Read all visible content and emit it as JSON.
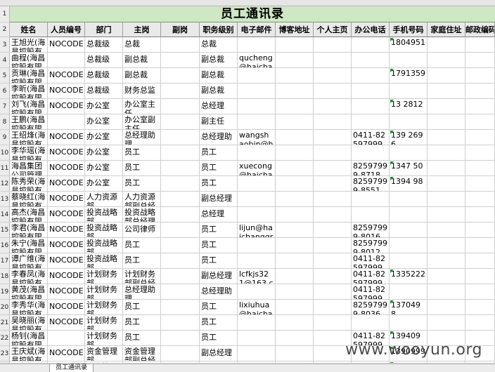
{
  "app": {
    "sheet_tab": "员工通讯录"
  },
  "title": "员工通讯录",
  "columns": [
    "姓名",
    "人员编号",
    "部门",
    "主岗",
    "副岗",
    "职务级别",
    "电子邮件",
    "博客地址",
    "个人主页",
    "办公电话",
    "手机号码",
    "家庭住址",
    "邮政编码"
  ],
  "row_numbers": [
    "1",
    "2",
    "3",
    "4",
    "5",
    "6",
    "7",
    "8",
    "9",
    "10",
    "11",
    "12",
    "13",
    "14",
    "15",
    "16",
    "17",
    "18",
    "19",
    "20",
    "21",
    "22",
    "23",
    "24"
  ],
  "rows": [
    {
      "name": "王旭光(海昌控股有",
      "code": "NOCODE",
      "dept": "总裁级",
      "main": "总裁",
      "sub": "",
      "level": "总裁",
      "email": "",
      "blog": "",
      "home": "",
      "phone": "",
      "mobile": "1804951"
    },
    {
      "name": "曲程(海昌控股有限",
      "code": "",
      "dept": "总裁级",
      "main": "副总裁",
      "sub": "",
      "level": "副总裁",
      "email": "qucheng@haichan",
      "blog": "",
      "home": "",
      "phone": "",
      "mobile": ""
    },
    {
      "name": "贡琳(海昌控股有限",
      "code": "NOCODE",
      "dept": "总裁级",
      "main": "副总裁",
      "sub": "",
      "level": "副总裁",
      "email": "",
      "blog": "",
      "home": "",
      "phone": "",
      "mobile": "1791359"
    },
    {
      "name": "李昕(海昌控股有限",
      "code": "NOCODE",
      "dept": "总裁级",
      "main": "财务总监",
      "sub": "",
      "level": "副总裁",
      "email": "",
      "blog": "",
      "home": "",
      "phone": "",
      "mobile": ""
    },
    {
      "name": "刘飞(海昌控股有限",
      "code": "NOCODE",
      "dept": "办公室",
      "main": "办公室主任",
      "sub": "",
      "level": "总经理",
      "email": "",
      "blog": "",
      "home": "",
      "phone": "",
      "mobile": "13 2812"
    },
    {
      "name": "王鹏(海昌控股有限",
      "code": "",
      "dept": "办公室",
      "main": "办公室副主任",
      "sub": "",
      "level": "副主任",
      "email": "",
      "blog": "",
      "home": "",
      "phone": "",
      "mobile": ""
    },
    {
      "name": "王绍烽(海昌控股有",
      "code": "NOCODE",
      "dept": "办公室",
      "main": "总经理助理",
      "sub": "",
      "level": "总经理助",
      "email": "wangshaobin@hai",
      "blog": "",
      "home": "",
      "phone": "0411-82597999",
      "mobile": "139 2696"
    },
    {
      "name": "李华瑶(海昌控股有",
      "code": "NOCODE",
      "dept": "办公室",
      "main": "员工",
      "sub": "",
      "level": "员工",
      "email": "",
      "blog": "",
      "home": "",
      "phone": "",
      "mobile": ""
    },
    {
      "name": "海昌集团公司管理",
      "code": "NOCODE",
      "dept": "办公室",
      "main": "员工",
      "sub": "",
      "level": "员工",
      "email": "xuecong@haichan",
      "blog": "",
      "home": "",
      "phone": "82597999-8718",
      "mobile": "1347 50"
    },
    {
      "name": "陈秀荣(海昌控股有",
      "code": "NOCODE",
      "dept": "办公室",
      "main": "员工",
      "sub": "",
      "level": "员工",
      "email": "",
      "blog": "",
      "home": "",
      "phone": "82597999-8551",
      "mobile": "1394 98"
    },
    {
      "name": "蔡晓红(海昌控股有",
      "code": "NOCODE",
      "dept": "人力资源部",
      "main": "人力资源部副总经",
      "sub": "",
      "level": "副总经理",
      "email": "",
      "blog": "",
      "home": "",
      "phone": "",
      "mobile": ""
    },
    {
      "name": "高杰(海昌控股有限",
      "code": "NOCODE",
      "dept": "投资战略部",
      "main": "投资战略部总经理",
      "sub": "",
      "level": "总经理",
      "email": "",
      "blog": "",
      "home": "",
      "phone": "",
      "mobile": ""
    },
    {
      "name": "李君(海昌控股有限",
      "code": "NOCODE",
      "dept": "投资战略部",
      "main": "公司律师",
      "sub": "",
      "level": "员工",
      "email": "lijun@haichanggrou",
      "blog": "",
      "home": "",
      "phone": "82597999-8016",
      "mobile": ""
    },
    {
      "name": "朱宁(海昌控股有限",
      "code": "NOCODE",
      "dept": "投资战略部",
      "main": "员工",
      "sub": "",
      "level": "员工",
      "email": "",
      "blog": "",
      "home": "",
      "phone": "82597999-8012",
      "mobile": ""
    },
    {
      "name": "谭广维(海昌控股有",
      "code": "NOCODE",
      "dept": "投资战略部",
      "main": "员工",
      "sub": "",
      "level": "员工",
      "email": "",
      "blog": "",
      "home": "",
      "phone": "0411-82597999",
      "mobile": ""
    },
    {
      "name": "李春凤(海昌控股有",
      "code": "NOCODE",
      "dept": "计划财务部",
      "main": "计划财务部副总经",
      "sub": "",
      "level": "副总经理",
      "email": "lcfkjs321@163.co",
      "blog": "",
      "home": "",
      "phone": "0411-82597999",
      "mobile": "1335222"
    },
    {
      "name": "黄茂(海昌控股有限",
      "code": "NOCODE",
      "dept": "计划财务部",
      "main": "总经理助理",
      "sub": "",
      "level": "总经理助",
      "email": "",
      "blog": "",
      "home": "",
      "phone": "0411-82597999",
      "mobile": ""
    },
    {
      "name": "李秀华(海昌控股有",
      "code": "NOCODE",
      "dept": "计划财务部",
      "main": "员工",
      "sub": "",
      "level": "员工",
      "email": "lixiuhua@haichang",
      "blog": "",
      "home": "",
      "phone": "82597999-8036",
      "mobile": "137049 8"
    },
    {
      "name": "吴晓丽(海昌控股有",
      "code": "NOCODE",
      "dept": "计划财务部",
      "main": "员工",
      "sub": "",
      "level": "员工",
      "email": "",
      "blog": "",
      "home": "",
      "phone": "",
      "mobile": ""
    },
    {
      "name": "杨钊(海昌控股有限",
      "code": "",
      "dept": "计划财务部",
      "main": "员工",
      "sub": "",
      "level": "员工",
      "email": "",
      "blog": "",
      "home": "",
      "phone": "0411-82597999",
      "mobile": "139409"
    },
    {
      "name": "王庆斌(海昌控股有",
      "code": "NOCODE",
      "dept": "资金管理部",
      "main": "资金管理部副总经",
      "sub": "",
      "level": "副总经理",
      "email": "",
      "blog": "",
      "home": "",
      "phone": "",
      "mobile": "1390999"
    },
    {
      "name": "刘冬梅(海昌控股有",
      "code": "",
      "dept": "资金管理部",
      "main": "资金管理",
      "sub": "",
      "level": "",
      "email": "",
      "blog": "",
      "home": "",
      "phone": "",
      "mobile": "135588"
    }
  ],
  "watermark": "www.wooyun.org"
}
